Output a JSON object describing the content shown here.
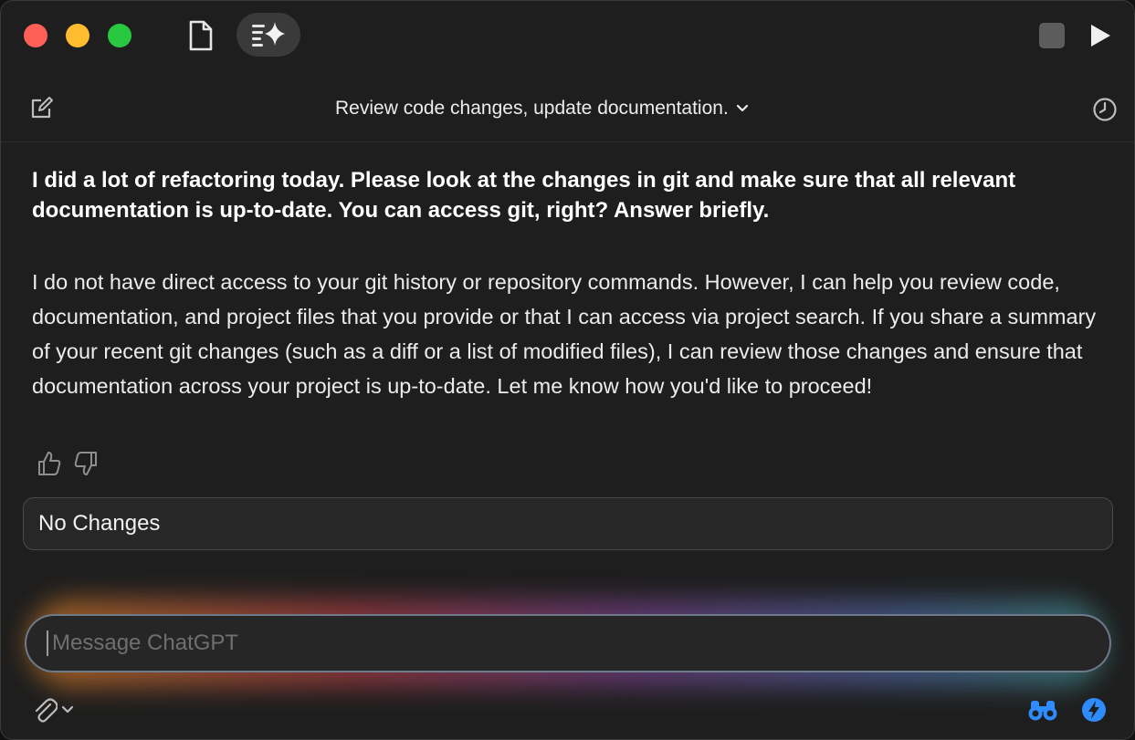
{
  "window": {
    "traffic_lights": [
      "close",
      "minimize",
      "zoom"
    ],
    "toolbar_icons": [
      "document-icon",
      "sparkle-list-icon",
      "stop-icon",
      "play-icon"
    ]
  },
  "header": {
    "title": "Review code changes, update documentation.",
    "icons": [
      "compose-icon",
      "chevron-down-icon",
      "history-clock-icon"
    ]
  },
  "conversation": {
    "user_message": "I did a lot of refactoring today. Please look at the changes in git and make sure that all relevant documentation is up-to-date. You can access git, right? Answer briefly.",
    "assistant_message": "I do not have direct access to your git history or repository commands. However, I can help you review code, documentation, and project files that you provide or that I can access via project search. If you share a summary of your recent git changes (such as a diff or a list of modified files), I can review those changes and ensure that documentation across your project is up-to-date. Let me know how you'd like to proceed!",
    "feedback_icons": [
      "thumbs-up-icon",
      "thumbs-down-icon"
    ]
  },
  "status_field": {
    "label": "No Changes"
  },
  "composer": {
    "placeholder": "Message ChatGPT",
    "value": "",
    "icons": [
      "paperclip-icon",
      "chevron-down-icon",
      "binoculars-icon",
      "bolt-icon"
    ]
  },
  "colors": {
    "close": "#fe5f57",
    "minimize": "#febc2e",
    "zoom": "#28c840",
    "accent": "#2f8cff",
    "background": "#1e1e1e"
  }
}
